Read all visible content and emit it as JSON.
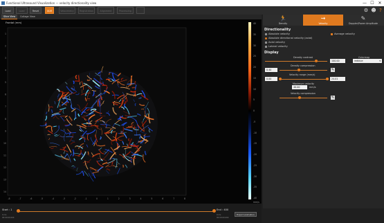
{
  "window": {
    "title": "Functional Ultrasound Visualization — velocity directionality view",
    "controls": {
      "minimize": "—",
      "maximize": "☐",
      "close": "✕"
    }
  },
  "toolbar": {
    "buttons": [
      {
        "label": "Load raw",
        "state": "normal"
      },
      {
        "label": "Load data",
        "state": "dim"
      },
      {
        "label": "Reset",
        "state": "normal"
      },
      {
        "label": "ULM",
        "state": "accent"
      },
      {
        "label": "Velocimetry",
        "state": "dim"
      },
      {
        "label": "Registration",
        "state": "dim"
      },
      {
        "label": "Alignment",
        "state": "dim"
      },
      {
        "label": "Processing",
        "state": "dim"
      },
      {
        "label": "",
        "state": "dim"
      }
    ],
    "icons": {
      "settings": "gear-icon",
      "user": "user-icon",
      "help": "help-icon"
    }
  },
  "view_tabs": [
    {
      "label": "Slice View",
      "active": true
    },
    {
      "label": "Collage View",
      "active": false
    }
  ],
  "image": {
    "label": "Frontal (mm)",
    "x_ticks": [
      "-8",
      "-7",
      "-6",
      "-5",
      "-4",
      "-3",
      "-2",
      "-1",
      "0",
      "1",
      "2",
      "3",
      "4",
      "5",
      "6",
      "7",
      "8"
    ],
    "y_ticks": [
      "1",
      "2",
      "3",
      "4",
      "5",
      "6",
      "7",
      "8",
      "9",
      "10",
      "11",
      "12",
      "13",
      "14"
    ]
  },
  "colorbar": {
    "ticks": [
      "40",
      "35",
      "30",
      "25",
      "20",
      "15",
      "10",
      "5",
      "0",
      "-5",
      "-10",
      "-15",
      "-20",
      "-25",
      "-30",
      "-35",
      "-40"
    ],
    "unit": "mm/s"
  },
  "timeline": {
    "start_label": "Start : 1",
    "end_label": "End : 400",
    "start_small": [
      "0  ms",
      "00:00:00.000"
    ],
    "end_small": [
      "0  ms",
      "00:00:00.000"
    ],
    "start_fraction": 0.0,
    "end_fraction": 1.0,
    "export_label": "Export animation"
  },
  "right_tabs": [
    {
      "label": "Density",
      "icon": "run-icon",
      "active": false
    },
    {
      "label": "Velocity",
      "icon": "flow-icon",
      "active": true
    },
    {
      "label": "Doppler/Power Amplitude",
      "icon": "brush-icon",
      "active": false
    }
  ],
  "directionality": {
    "title": "Directionality",
    "options": [
      {
        "label": "Absolute velocity",
        "selected": false
      },
      {
        "label": "Absolute directional velocity (axial)",
        "selected": true
      },
      {
        "label": "Axial velocity",
        "selected": false
      },
      {
        "label": "Lateral velocity",
        "selected": false
      }
    ],
    "average_velocity": "Average velocity"
  },
  "display": {
    "title": "Display",
    "density_contrast_label": "Density contrast",
    "density_contrast_value": "100.00",
    "density_contrast_fraction": 0.82,
    "colormap_label": "Colormap",
    "colormap_value": "redblue",
    "density_compression_label": "Density compression",
    "density_compression_value": "0.40",
    "density_compression_fraction": 0.4,
    "velocity_range_label": "Velocity range (mm/s)",
    "velocity_min": "0.00",
    "velocity_max": "24.01",
    "max_velocity_label": "Maximum velocity",
    "max_velocity_value": "40.00",
    "max_velocity_unit": "mm/s",
    "velocity_compression_label": "Velocity compression",
    "velocity_compression_fraction": 0.42
  }
}
